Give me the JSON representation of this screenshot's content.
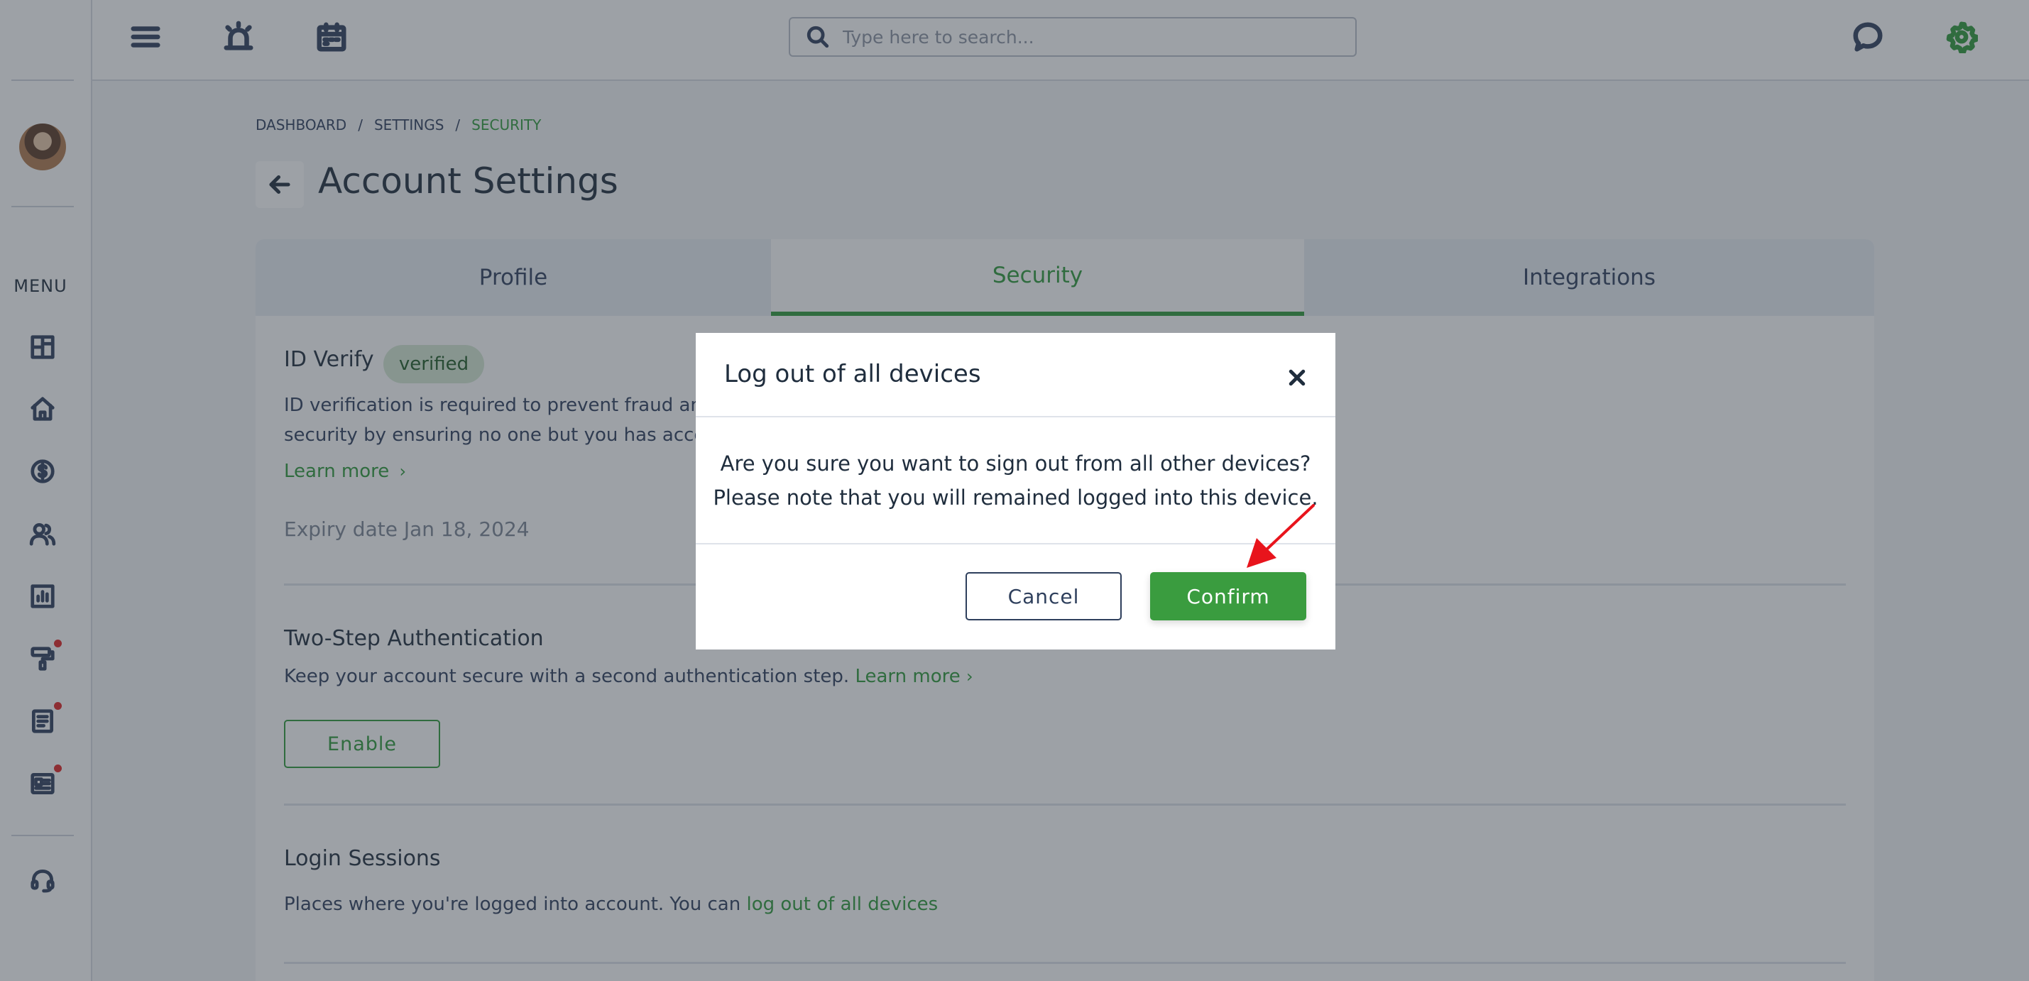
{
  "sidebar": {
    "menu_label": "MENU",
    "icons": [
      "dashboard-icon",
      "home-icon",
      "dollar-icon",
      "users-icon",
      "chart-icon",
      "paint-roller-icon",
      "document-icon",
      "news-icon",
      "headset-icon"
    ]
  },
  "topbar": {
    "search_placeholder": "Type here to search...",
    "icons": [
      "menu-icon",
      "alarm-icon",
      "calendar-icon",
      "chat-icon",
      "settings-icon"
    ],
    "accent": "#2e9a3b"
  },
  "breadcrumb": {
    "items": [
      "DASHBOARD",
      "SETTINGS",
      "SECURITY"
    ],
    "separator": "/"
  },
  "page": {
    "title": "Account Settings"
  },
  "tabs": {
    "items": [
      "Profile",
      "Security",
      "Integrations"
    ],
    "active": "Security"
  },
  "id_verify": {
    "title": "ID Verify",
    "badge": "verified",
    "text_line1": "ID verification is required to prevent fraud and h",
    "text_line2": "security by ensuring no one but you has access",
    "learn_more": "Learn more",
    "expiry": "Expiry date Jan 18, 2024"
  },
  "two_step": {
    "title": "Two-Step Authentication",
    "text": "Keep your account secure with a second authentication step.",
    "learn_more": "Learn more",
    "enable_label": "Enable"
  },
  "login_sessions": {
    "title": "Login Sessions",
    "text": "Places where you're logged into account. You can",
    "link": "log out of all devices"
  },
  "modal": {
    "title": "Log out of all devices",
    "body_line1": "Are you sure you want to sign out from all other devices?",
    "body_line2": "Please note that you will remained logged into this device.",
    "cancel_label": "Cancel",
    "confirm_label": "Confirm",
    "confirm_color": "#3a9c3f"
  }
}
